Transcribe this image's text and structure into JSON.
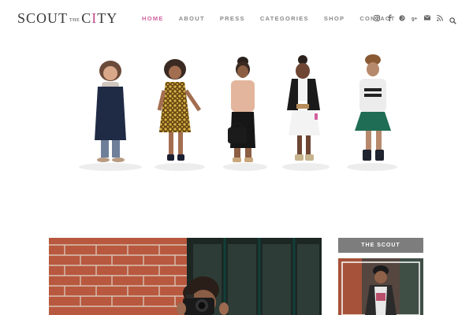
{
  "brand": {
    "logo_left": "SCOUT",
    "logo_small": "THE",
    "logo_right_c": "C",
    "logo_right_i": "I",
    "logo_right_ty": "TY",
    "accent_color": "#d1609f"
  },
  "nav": {
    "items": [
      {
        "label": "HOME",
        "active": true
      },
      {
        "label": "ABOUT",
        "active": false
      },
      {
        "label": "PRESS",
        "active": false
      },
      {
        "label": "CATEGORIES",
        "active": false
      },
      {
        "label": "SHOP",
        "active": false
      },
      {
        "label": "CONTACT",
        "active": false
      }
    ]
  },
  "social_icons": [
    "instagram-icon",
    "facebook-icon",
    "pinterest-icon",
    "google-plus-icon",
    "email-icon",
    "rss-icon"
  ],
  "search_icon": "search-icon",
  "sidebar": {
    "widget_title": "THE SCOUT"
  }
}
